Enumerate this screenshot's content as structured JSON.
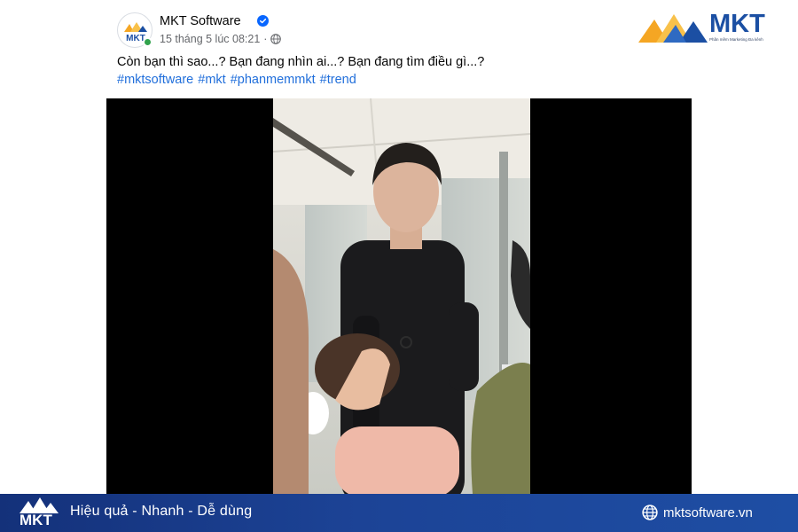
{
  "post": {
    "page_name": "MKT Software",
    "timestamp": "15 tháng 5 lúc 08:21",
    "separator": "·",
    "text": "Còn bạn thì sao...? Bạn đang nhìn ai...? Bạn đang tìm điều gì...?",
    "hashtags": [
      "#mktsoftware",
      "#mkt",
      "#phanmemmkt",
      "#trend"
    ]
  },
  "avatar": {
    "word": "MKT"
  },
  "brand": {
    "word": "MKT",
    "tagline": "Phần mềm Marketing Đa kênh"
  },
  "footer": {
    "logo_word": "MKT",
    "slogan": "Hiệu quả - Nhanh - Dễ dùng",
    "website": "mktsoftware.vn"
  },
  "colors": {
    "brand_blue": "#1b4fa3",
    "brand_orange": "#f5a623",
    "link_blue": "#216fdb",
    "verified_blue": "#0866ff",
    "online_green": "#31a24c",
    "footer_bar": "#1c4396"
  },
  "icons": {
    "verified": "verified-badge-icon",
    "privacy": "globe-icon",
    "website": "globe-icon"
  }
}
